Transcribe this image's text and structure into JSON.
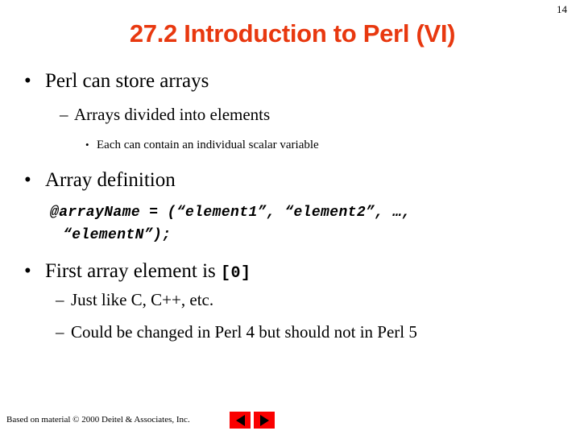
{
  "slide": {
    "page_number": "14",
    "title": "27.2 Introduction to Perl (VI)",
    "title_color": "#E8380F",
    "background_color": "#FFFFFF"
  },
  "content": {
    "bullet_1": {
      "marker": "•",
      "text": "Perl can store arrays"
    },
    "bullet_1_sub_1": {
      "marker": "–",
      "text": "Arrays divided into elements"
    },
    "bullet_1_sub_1_sub_1": {
      "marker": "•",
      "text": "Each can contain an individual scalar variable"
    },
    "bullet_2": {
      "marker": "•",
      "text": "Array definition"
    },
    "code_block": {
      "line_1": "@arrayName = (“element1”, “element2”, …,",
      "line_2": "“elementN”);"
    },
    "bullet_3": {
      "marker": "•",
      "text_before": "First array element is ",
      "code": "[0]"
    },
    "bullet_3_sub_1": {
      "marker": "–",
      "text": "Just like C, C++, etc."
    },
    "bullet_3_sub_2": {
      "marker": "–",
      "text": "Could be changed in Perl 4 but should not in Perl 5"
    }
  },
  "footer": {
    "attribution": "Based on material © 2000 Deitel & Associates, Inc.",
    "nav_prev_icon": "triangle-left",
    "nav_next_icon": "triangle-right",
    "nav_button_color": "#FA0000"
  }
}
